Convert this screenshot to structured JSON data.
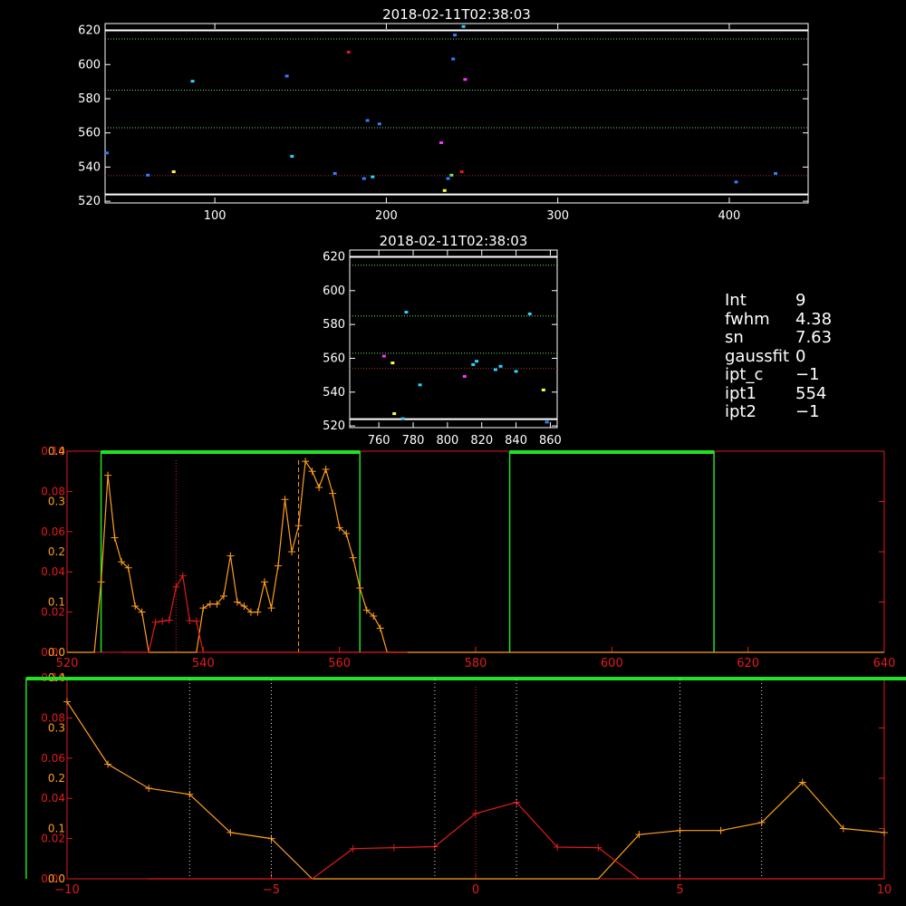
{
  "colors": {
    "background": "#000000",
    "axis": "#ffffff",
    "grid_green": "#6ee06e",
    "grid_red": "#c02828",
    "orange": "#ff9f1c",
    "red": "#e11b1b",
    "band": "#22e022",
    "blue": "#2f7fff",
    "cyan": "#2fd0ff",
    "magenta": "#ff30ff",
    "yellow": "#ffff40"
  },
  "info": [
    {
      "key": "Int",
      "value": "9"
    },
    {
      "key": "fwhm",
      "value": "4.38"
    },
    {
      "key": "sn",
      "value": "7.63"
    },
    {
      "key": "gaussfit",
      "value": "0"
    },
    {
      "key": "ipt_c",
      "value": "−1"
    },
    {
      "key": "ipt1",
      "value": "554"
    },
    {
      "key": "ipt2",
      "value": "−1"
    }
  ],
  "chart_data": [
    {
      "type": "scatter",
      "title": "2018-02-11T02:38:03",
      "xlim": [
        36,
        446
      ],
      "ylim": [
        519,
        624
      ],
      "xticks": [
        100,
        200,
        300,
        400
      ],
      "yticks": [
        520,
        540,
        560,
        580,
        600,
        620
      ],
      "hlines": [
        {
          "y": 524,
          "color": "white",
          "style": "solid"
        },
        {
          "y": 620,
          "color": "white",
          "style": "solid"
        },
        {
          "y": 615,
          "color": "green",
          "style": "dotted"
        },
        {
          "y": 585,
          "color": "green",
          "style": "dotted"
        },
        {
          "y": 563,
          "color": "green",
          "style": "dotted"
        },
        {
          "y": 535,
          "color": "red",
          "style": "dotted"
        }
      ],
      "points": [
        {
          "x": 37,
          "y": 548,
          "c": "blue"
        },
        {
          "x": 61,
          "y": 535,
          "c": "blue"
        },
        {
          "x": 76,
          "y": 537,
          "c": "yellow"
        },
        {
          "x": 87,
          "y": 590,
          "c": "cyan"
        },
        {
          "x": 142,
          "y": 593,
          "c": "blue"
        },
        {
          "x": 145,
          "y": 546,
          "c": "cyan"
        },
        {
          "x": 170,
          "y": 536,
          "c": "blue"
        },
        {
          "x": 178,
          "y": 607,
          "c": "red"
        },
        {
          "x": 187,
          "y": 533,
          "c": "blue"
        },
        {
          "x": 189,
          "y": 567,
          "c": "blue"
        },
        {
          "x": 192,
          "y": 534,
          "c": "cyan"
        },
        {
          "x": 196,
          "y": 565,
          "c": "blue"
        },
        {
          "x": 232,
          "y": 554,
          "c": "magenta"
        },
        {
          "x": 234,
          "y": 526,
          "c": "yellow"
        },
        {
          "x": 236,
          "y": 533,
          "c": "blue"
        },
        {
          "x": 238,
          "y": 535,
          "c": "green"
        },
        {
          "x": 239,
          "y": 603,
          "c": "blue"
        },
        {
          "x": 240,
          "y": 617,
          "c": "blue"
        },
        {
          "x": 244,
          "y": 537,
          "c": "red"
        },
        {
          "x": 245,
          "y": 622,
          "c": "cyan"
        },
        {
          "x": 246,
          "y": 591,
          "c": "magenta"
        },
        {
          "x": 404,
          "y": 531,
          "c": "blue"
        },
        {
          "x": 427,
          "y": 536,
          "c": "blue"
        }
      ]
    },
    {
      "type": "scatter",
      "title": "2018-02-11T02:38:03",
      "xlim": [
        743,
        864
      ],
      "ylim": [
        519,
        624
      ],
      "xticks": [
        760,
        780,
        800,
        820,
        840,
        860
      ],
      "yticks": [
        520,
        540,
        560,
        580,
        600,
        620
      ],
      "hlines": [
        {
          "y": 524,
          "color": "white",
          "style": "solid"
        },
        {
          "y": 620,
          "color": "white",
          "style": "solid"
        },
        {
          "y": 615,
          "color": "green",
          "style": "dotted"
        },
        {
          "y": 585,
          "color": "green",
          "style": "dotted"
        },
        {
          "y": 563,
          "color": "green",
          "style": "dotted"
        },
        {
          "y": 554,
          "color": "red",
          "style": "dotted"
        }
      ],
      "points": [
        {
          "x": 763,
          "y": 561,
          "c": "magenta"
        },
        {
          "x": 768,
          "y": 557,
          "c": "yellow"
        },
        {
          "x": 769,
          "y": 527,
          "c": "yellow"
        },
        {
          "x": 774,
          "y": 524,
          "c": "cyan"
        },
        {
          "x": 776,
          "y": 587,
          "c": "cyan"
        },
        {
          "x": 784,
          "y": 544,
          "c": "cyan"
        },
        {
          "x": 810,
          "y": 549,
          "c": "magenta"
        },
        {
          "x": 815,
          "y": 556,
          "c": "cyan"
        },
        {
          "x": 817,
          "y": 558,
          "c": "cyan"
        },
        {
          "x": 828,
          "y": 553,
          "c": "cyan"
        },
        {
          "x": 831,
          "y": 555,
          "c": "cyan"
        },
        {
          "x": 840,
          "y": 552,
          "c": "cyan"
        },
        {
          "x": 848,
          "y": 586,
          "c": "cyan"
        },
        {
          "x": 856,
          "y": 541,
          "c": "yellow"
        },
        {
          "x": 858,
          "y": 522,
          "c": "blue"
        }
      ]
    },
    {
      "type": "line",
      "xlim": [
        520,
        640
      ],
      "ylim_left": [
        0,
        0.1
      ],
      "ylim_right": [
        0,
        0.4
      ],
      "xticks": [
        520,
        540,
        560,
        580,
        600,
        620,
        640
      ],
      "yticks_left": [
        0.0,
        0.02,
        0.04,
        0.06,
        0.08,
        0.1
      ],
      "yticks_right": [
        0.0,
        0.1,
        0.2,
        0.3,
        0.4
      ],
      "bands": [
        {
          "from": 525,
          "to": 563
        },
        {
          "from": 585,
          "to": 615
        }
      ],
      "vlines": [
        {
          "x": 536,
          "color": "red",
          "style": "dotted"
        },
        {
          "x": 554,
          "color": "orange",
          "style": "dashed"
        }
      ],
      "series": [
        {
          "color": "orange",
          "x": [
            520,
            521,
            522,
            523,
            524,
            525,
            526,
            527,
            528,
            529,
            530,
            531,
            532,
            533,
            534,
            535,
            536,
            537,
            538,
            539,
            540,
            541,
            542,
            543,
            544,
            545,
            546,
            547,
            548,
            549,
            550,
            551,
            552,
            553,
            554,
            555,
            556,
            557,
            558,
            559,
            560,
            561,
            562,
            563,
            564,
            565,
            566,
            567,
            568,
            569,
            570,
            571,
            572,
            573,
            574,
            575,
            576,
            577,
            578,
            579,
            580,
            581,
            582,
            583,
            584,
            585,
            586,
            587,
            588,
            589,
            590,
            591,
            592,
            593,
            594,
            595,
            596,
            597,
            598,
            599,
            600,
            601,
            602,
            603,
            604,
            605,
            606,
            607,
            608,
            609,
            610,
            611,
            612,
            613,
            614,
            615,
            616,
            617,
            618,
            619,
            620,
            621,
            622,
            623,
            624,
            625,
            626,
            627,
            628,
            629,
            630,
            631,
            632,
            633,
            634,
            635,
            636,
            637,
            638,
            639,
            640
          ],
          "y": [
            0.0,
            0.0,
            0.0,
            0.0,
            0.0,
            0.035,
            0.088,
            0.057,
            0.045,
            0.042,
            0.023,
            0.02,
            0.0,
            0.0,
            0.0,
            0.0,
            0.0,
            0.0,
            0.0,
            0.0,
            0.022,
            0.024,
            0.024,
            0.028,
            0.048,
            0.025,
            0.023,
            0.02,
            0.02,
            0.035,
            0.022,
            0.043,
            0.076,
            0.05,
            0.063,
            0.095,
            0.09,
            0.082,
            0.091,
            0.079,
            0.062,
            0.059,
            0.047,
            0.032,
            0.021,
            0.018,
            0.012,
            0.0,
            0.0,
            0.0,
            0.0,
            0.0,
            0.0,
            0.0,
            0.0,
            0.0,
            0.0,
            0.0,
            0.0,
            0.0,
            0.0,
            0.0,
            0.0,
            0.0,
            0.0,
            0.0,
            0.0,
            0.0,
            0.0,
            0.0,
            0.0,
            0.0,
            0.0,
            0.0,
            0.0,
            0.0,
            0.0,
            0.0,
            0.0,
            0.0,
            0.0,
            0.0,
            0.0,
            0.0,
            0.0,
            0.0,
            0.0,
            0.0,
            0.0,
            0.0,
            0.0,
            0.0,
            0.0,
            0.0,
            0.0,
            0.0,
            0.0,
            0.0,
            0.0,
            0.0,
            0.0,
            0.0,
            0.0,
            0.0,
            0.0,
            0.0,
            0.0,
            0.0,
            0.0,
            0.0,
            0.0,
            0.0,
            0.0,
            0.0,
            0.0,
            0.0,
            0.0,
            0.0,
            0.0,
            0.0,
            0.0
          ]
        },
        {
          "color": "red",
          "x": [
            528,
            529,
            530,
            531,
            532,
            533,
            534,
            535,
            536,
            537,
            538,
            539,
            540,
            541,
            542,
            543,
            544,
            545,
            546,
            547,
            548,
            549,
            550,
            551,
            552,
            553,
            554,
            555,
            556,
            557,
            558,
            559,
            560,
            561,
            562,
            563,
            564,
            565,
            566,
            567,
            568,
            569,
            570
          ],
          "y": [
            0.0,
            0.0,
            0.0,
            0.0,
            0.0,
            0.06,
            0.062,
            0.064,
            0.13,
            0.152,
            0.063,
            0.062,
            0.0,
            0.0,
            0.0,
            0.0,
            0.0,
            0.0,
            0.0,
            0.0,
            0.0,
            0.0,
            0.0,
            0.0,
            0.0,
            0.0,
            0.0,
            0.0,
            0.0,
            0.0,
            0.0,
            0.0,
            0.0,
            0.0,
            0.0,
            0.0,
            0.0,
            0.0,
            0.0,
            0.0,
            0.0,
            0.0,
            0.0
          ]
        }
      ]
    }
  ]
}
